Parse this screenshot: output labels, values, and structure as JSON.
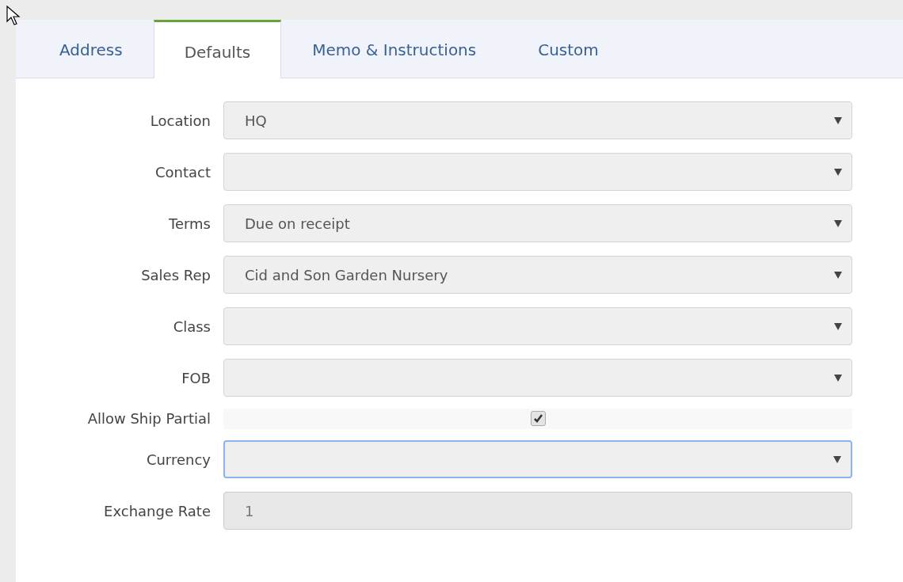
{
  "tabs": [
    {
      "label": "Address",
      "selected": false
    },
    {
      "label": "Defaults",
      "selected": true
    },
    {
      "label": "Memo & Instructions",
      "selected": false
    },
    {
      "label": "Custom",
      "selected": false
    }
  ],
  "fields": [
    {
      "label": "Location",
      "kind": "select",
      "value": "HQ",
      "focused": false
    },
    {
      "label": "Contact",
      "kind": "select",
      "focused": false
    },
    {
      "label": "Terms",
      "kind": "select",
      "value": "Due on receipt",
      "focused": false
    },
    {
      "label": "Sales Rep",
      "kind": "select",
      "value": "Cid and Son Garden Nursery",
      "focused": false
    },
    {
      "label": "Class",
      "kind": "select",
      "focused": false
    },
    {
      "label": "FOB",
      "kind": "select",
      "focused": false
    },
    {
      "label": "Allow Ship Partial",
      "kind": "checkbox",
      "checked": true
    },
    {
      "label": "Currency",
      "kind": "select",
      "focused": true
    },
    {
      "label": "Exchange Rate",
      "kind": "text",
      "value": "1",
      "disabled": true
    }
  ]
}
